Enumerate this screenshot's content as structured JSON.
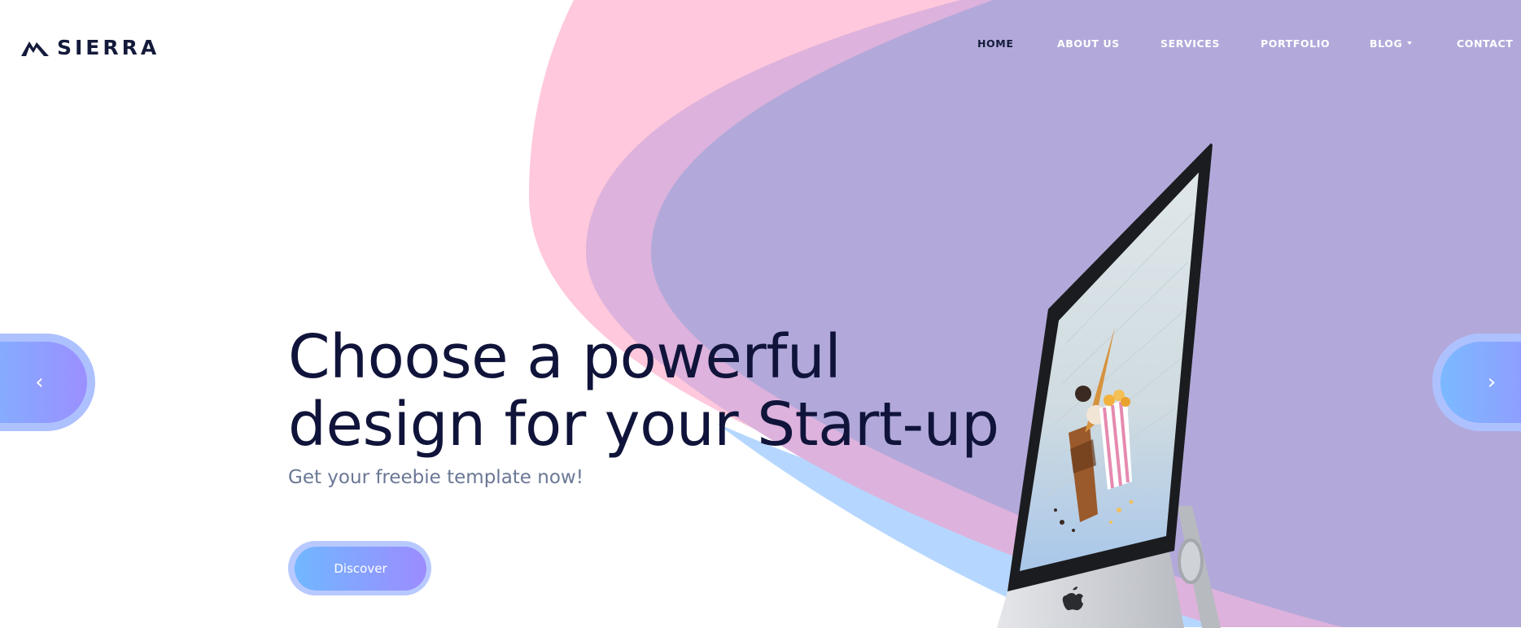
{
  "brand": {
    "name": "SIERRA",
    "logo_icon": "mountain-icon"
  },
  "nav": {
    "items": [
      {
        "label": "HOME",
        "active": true
      },
      {
        "label": "ABOUT US",
        "active": false
      },
      {
        "label": "SERVICES",
        "active": false
      },
      {
        "label": "PORTFOLIO",
        "active": false
      },
      {
        "label": "BLOG",
        "active": false,
        "dropdown": true
      },
      {
        "label": "CONTACT",
        "active": false
      }
    ]
  },
  "hero": {
    "title_line1": "Choose a powerful",
    "title_line2": "design for your Start-up",
    "subtitle": "Get your freebie template now!",
    "cta_label": "Discover"
  },
  "slider": {
    "prev_icon": "chevron-left-icon",
    "next_icon": "chevron-right-icon"
  },
  "colors": {
    "title": "#10143a",
    "subtitle": "#6a7795",
    "blob_pink": "#ffc8dc",
    "blob_mauve": "#ddb2dc",
    "blob_purple": "#b2a9da",
    "blob_blue": "#a8d0ff",
    "button_gradient_start": "#71b7ff",
    "button_gradient_end": "#9c8cff"
  }
}
